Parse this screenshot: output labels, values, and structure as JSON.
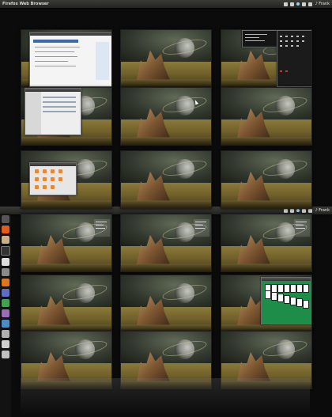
{
  "top_panel": {
    "app_title": "Firefox Web Browser",
    "clock": "♪ Frank",
    "indicators": [
      "network-icon",
      "mail-icon",
      "battery-icon",
      "volume-icon",
      "user-icon"
    ]
  },
  "bottom_panel": {
    "clock": "♪ Frank",
    "indicators": [
      "network-icon",
      "mail-icon",
      "battery-icon",
      "volume-icon",
      "user-icon"
    ]
  },
  "launcher_items": [
    "ubuntu-logo",
    "firefox",
    "files",
    "terminal",
    "text-editor",
    "settings",
    "software-center",
    "libreoffice-writer",
    "libreoffice-calc",
    "image-viewer",
    "music",
    "system",
    "trash",
    "workspace-switcher"
  ],
  "colors": {
    "panel": "#2e2e2b",
    "background": "#0b0b0b",
    "solitaire_green": "#1f8d4a"
  }
}
